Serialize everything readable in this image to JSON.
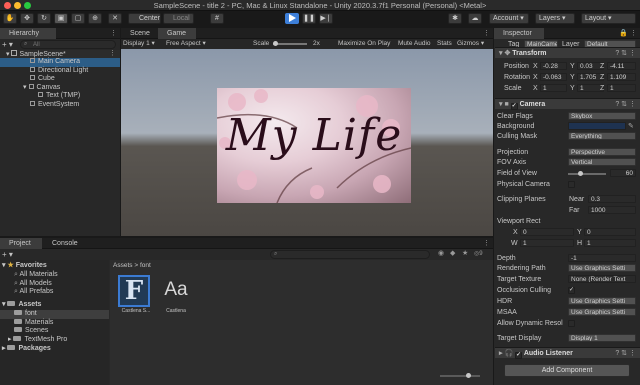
{
  "window": {
    "title": "SampleScene - title 2 - PC, Mac & Linux Standalone - Unity 2020.3.7f1 Personal (Personal) <Metal>",
    "traffic_colors": [
      "#ff5f57",
      "#febc2e",
      "#28c840"
    ]
  },
  "toolbar": {
    "pivot": "Center",
    "space": "Local",
    "account": "Account",
    "layers": "Layers",
    "layout": "Layout",
    "play_color": "#3d7fd9"
  },
  "hierarchy": {
    "tab": "Hierarchy",
    "search_placeholder": "All",
    "scene": "SampleScene*",
    "items": [
      {
        "label": "Main Camera"
      },
      {
        "label": "Directional Light"
      },
      {
        "label": "Cube"
      },
      {
        "label": "Canvas"
      },
      {
        "label": "Text (TMP)"
      },
      {
        "label": "EventSystem"
      }
    ]
  },
  "game": {
    "scene_tab": "Scene",
    "game_tab": "Game",
    "display": "Display 1",
    "aspect": "Free Aspect",
    "scale_label": "Scale",
    "scale_value": "2x",
    "maximize": "Maximize On Play",
    "mute": "Mute Audio",
    "stats": "Stats",
    "gizmos": "Gizmos",
    "overlay_text": "My Life"
  },
  "project": {
    "project_tab": "Project",
    "console_tab": "Console",
    "count": "9",
    "favorites_label": "Favorites",
    "favorites": [
      "All Materials",
      "All Models",
      "All Prefabs"
    ],
    "assets_label": "Assets",
    "asset_folders": [
      "font",
      "Materials",
      "Scenes",
      "TextMesh Pro"
    ],
    "packages_label": "Packages",
    "breadcrumb_root": "Assets",
    "breadcrumb_sep": ">",
    "breadcrumb_leaf": "font",
    "files": [
      {
        "glyph": "F",
        "label": "Castlena S..."
      },
      {
        "glyph": "Aa",
        "label": "Castlena"
      }
    ]
  },
  "inspector": {
    "tab": "Inspector",
    "tag_label": "Tag",
    "tag_value": "MainCame",
    "layer_label": "Layer",
    "layer_value": "Default",
    "transform": {
      "title": "Transform",
      "rows": [
        {
          "label": "Position",
          "x": "-0.28",
          "y": "0.03",
          "z": "-4.11"
        },
        {
          "label": "Rotation",
          "x": "-0.063",
          "y": "1.705",
          "z": "1.109"
        },
        {
          "label": "Scale",
          "x": "1",
          "y": "1",
          "z": "1"
        }
      ]
    },
    "camera": {
      "title": "Camera",
      "clear_flags_label": "Clear Flags",
      "clear_flags": "Skybox",
      "background_label": "Background",
      "background_color": "#1e3250",
      "culling_label": "Culling Mask",
      "culling": "Everything",
      "projection_label": "Projection",
      "projection": "Perspective",
      "fov_axis_label": "FOV Axis",
      "fov_axis": "Vertical",
      "fov_label": "Field of View",
      "fov_value": "60",
      "fov_fraction": 0.33,
      "physical_label": "Physical Camera",
      "clipping_label": "Clipping Planes",
      "near_label": "Near",
      "near": "0.3",
      "far_label": "Far",
      "far": "1000",
      "viewport_label": "Viewport Rect",
      "vx_label": "X",
      "vx": "0",
      "vy_label": "Y",
      "vy": "0",
      "vw_label": "W",
      "vw": "1",
      "vh_label": "H",
      "vh": "1",
      "depth_label": "Depth",
      "depth": "-1",
      "rendering_label": "Rendering Path",
      "rendering": "Use Graphics Setti",
      "target_tex_label": "Target Texture",
      "target_tex": "None (Render Text",
      "occlusion_label": "Occlusion Culling",
      "occlusion_check": "✓",
      "hdr_label": "HDR",
      "hdr": "Use Graphics Setti",
      "msaa_label": "MSAA",
      "msaa": "Use Graphics Setti",
      "dyn_label": "Allow Dynamic Resol",
      "target_display_label": "Target Display",
      "target_display": "Display 1"
    },
    "audio": {
      "title": "Audio Listener"
    },
    "add_component": "Add Component"
  }
}
